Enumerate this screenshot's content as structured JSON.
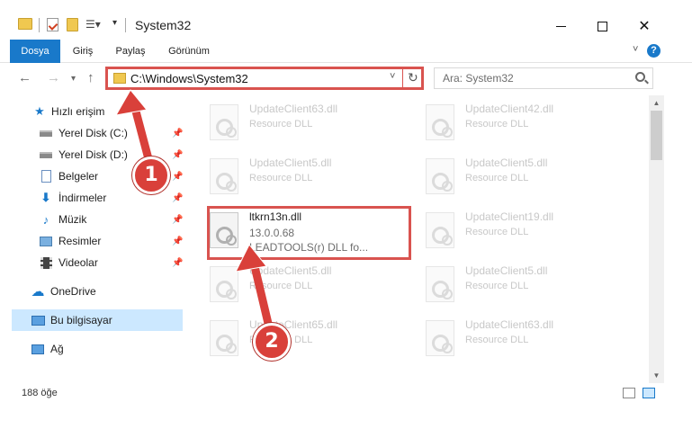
{
  "window": {
    "title": "System32"
  },
  "ribbon": {
    "tabs": [
      {
        "label": "Dosya",
        "active": true
      },
      {
        "label": "Giriş"
      },
      {
        "label": "Paylaş"
      },
      {
        "label": "Görünüm"
      }
    ]
  },
  "nav": {
    "address": "C:\\Windows\\System32",
    "search_placeholder": "Ara: System32"
  },
  "sidebar": {
    "items": [
      {
        "label": "Hızlı erişim",
        "icon": "star-icon"
      },
      {
        "label": "Yerel Disk (C:)",
        "icon": "drive-icon",
        "pinned": true
      },
      {
        "label": "Yerel Disk (D:)",
        "icon": "drive-icon",
        "pinned": true
      },
      {
        "label": "Belgeler",
        "icon": "documents-icon",
        "pinned": true
      },
      {
        "label": "İndirmeler",
        "icon": "downloads-icon",
        "pinned": true
      },
      {
        "label": "Müzik",
        "icon": "music-icon",
        "pinned": true
      },
      {
        "label": "Resimler",
        "icon": "pictures-icon",
        "pinned": true
      },
      {
        "label": "Videolar",
        "icon": "videos-icon",
        "pinned": true
      },
      {
        "label": "OneDrive",
        "icon": "onedrive-icon"
      },
      {
        "label": "Bu bilgisayar",
        "icon": "computer-icon",
        "selected": true
      },
      {
        "label": "Ağ",
        "icon": "network-icon"
      }
    ]
  },
  "files": [
    {
      "name": "UpdateClient63.dll",
      "desc": "Resource DLL"
    },
    {
      "name": "UpdateClient42.dll",
      "desc": "Resource DLL"
    },
    {
      "name": "UpdateClient5.dll",
      "desc": "Resource DLL"
    },
    {
      "name": "UpdateClient5.dll",
      "desc": "Resource DLL"
    },
    {
      "name": "ltkrn13n.dll",
      "version": "13.0.0.68",
      "desc": "LEADTOOLS(r) DLL fo..."
    },
    {
      "name": "UpdateClient19.dll",
      "desc": "Resource DLL"
    },
    {
      "name": "UpdateClient5.dll",
      "desc": "Resource DLL"
    },
    {
      "name": "UpdateClient5.dll",
      "desc": "Resource DLL"
    },
    {
      "name": "UpdateClient65.dll",
      "desc": "Resource DLL"
    },
    {
      "name": "UpdateClient63.dll",
      "desc": "Resource DLL"
    }
  ],
  "status": {
    "item_count": "188 öğe"
  },
  "callouts": {
    "step1": "1",
    "step2": "2"
  },
  "colors": {
    "accent": "#1979ca",
    "highlight": "#d9534f",
    "selected_bg": "#cce8ff"
  }
}
